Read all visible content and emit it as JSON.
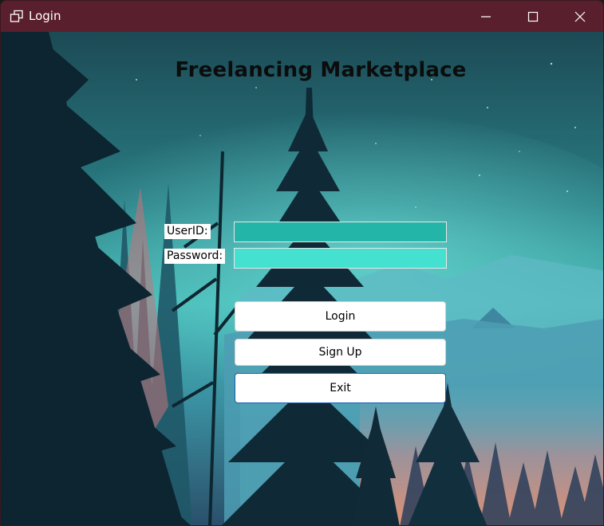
{
  "window": {
    "title": "Login",
    "titlebar_color": "#5a1f2c",
    "icons": {
      "app": "app-window-icon",
      "minimize": "minimize-icon",
      "maximize": "maximize-icon",
      "close": "close-icon"
    }
  },
  "form": {
    "heading": "Freelancing Marketplace",
    "userid_label": "UserID:",
    "password_label": "Password:",
    "userid_value": "",
    "password_value": "",
    "userid_color": "#22b5a8",
    "password_color": "#45e1d0"
  },
  "buttons": {
    "login": "Login",
    "signup": "Sign Up",
    "exit": "Exit"
  },
  "background": {
    "description_colors": {
      "sky_top": "#1d4e57",
      "sky_mid": "#3aa6a6",
      "tree_dark": "#0d2730",
      "sunset": "#e88a7a"
    }
  }
}
